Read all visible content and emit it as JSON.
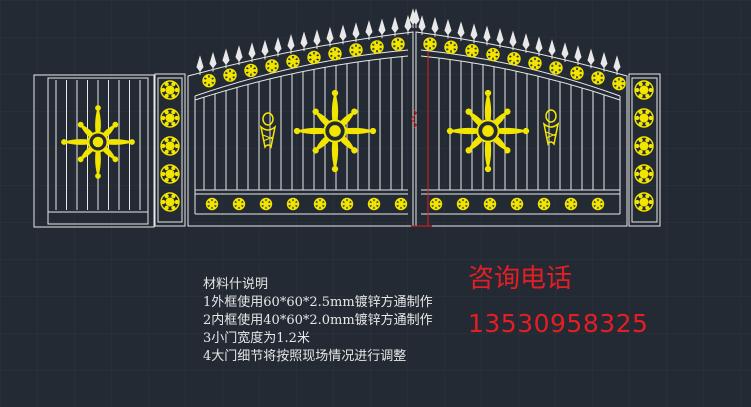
{
  "palette": {
    "background": "#232a33",
    "grid": "#2e3640",
    "outline": "#e8e8e8",
    "ornament": "#f2e600",
    "accent": "#e31e24"
  },
  "notes": {
    "title": "材料什说明",
    "items": [
      "1外框使用60*60*2.5mm镀锌方通制作",
      "2内框使用40*60*2.0mm镀锌方通制作",
      "3小门宽度为1.2米",
      "4大门细节将按照现场情况进行调整"
    ]
  },
  "contact": {
    "label": "咨询电话",
    "phone": "13530958325"
  }
}
